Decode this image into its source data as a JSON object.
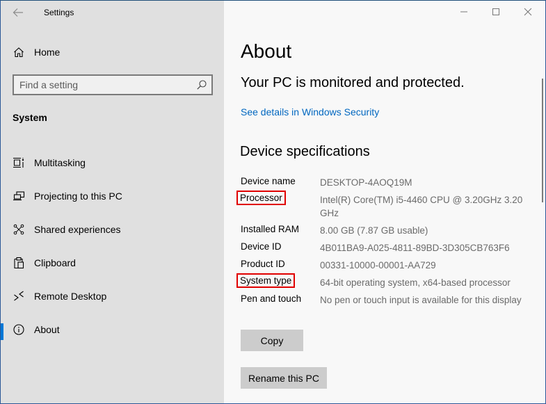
{
  "window": {
    "title": "Settings",
    "controls": {
      "minimize": "minimize",
      "maximize": "maximize",
      "close": "close"
    }
  },
  "colors": {
    "accent": "#0078d7",
    "link": "#0067c0",
    "highlight_box": "#e00000",
    "sidebar_bg": "#e0e0e0",
    "content_bg": "#f8f8f8",
    "button_bg": "#cccccc"
  },
  "sidebar": {
    "home_label": "Home",
    "search": {
      "placeholder": "Find a setting",
      "value": ""
    },
    "section": "System",
    "items": [
      {
        "label": "Multitasking",
        "icon": "multitasking-icon"
      },
      {
        "label": "Projecting to this PC",
        "icon": "projecting-icon"
      },
      {
        "label": "Shared experiences",
        "icon": "shared-experiences-icon"
      },
      {
        "label": "Clipboard",
        "icon": "clipboard-icon"
      },
      {
        "label": "Remote Desktop",
        "icon": "remote-desktop-icon"
      },
      {
        "label": "About",
        "icon": "info-icon",
        "active": true
      }
    ]
  },
  "main": {
    "title": "About",
    "status": "Your PC is monitored and protected.",
    "security_link": "See details in Windows Security",
    "specs_heading": "Device specifications",
    "specs": [
      {
        "label": "Device name",
        "value": "DESKTOP-4AOQ19M",
        "highlighted": false
      },
      {
        "label": "Processor",
        "value": "Intel(R) Core(TM) i5-4460  CPU @ 3.20GHz   3.20 GHz",
        "highlighted": true
      },
      {
        "label": "Installed RAM",
        "value": "8.00 GB (7.87 GB usable)",
        "highlighted": false
      },
      {
        "label": "Device ID",
        "value": "4B011BA9-A025-4811-89BD-3D305CB763F6",
        "highlighted": false
      },
      {
        "label": "Product ID",
        "value": "00331-10000-00001-AA729",
        "highlighted": false
      },
      {
        "label": "System type",
        "value": "64-bit operating system, x64-based processor",
        "highlighted": true
      },
      {
        "label": "Pen and touch",
        "value": "No pen or touch input is available for this display",
        "highlighted": false
      }
    ],
    "copy_button": "Copy",
    "rename_button": "Rename this PC"
  }
}
